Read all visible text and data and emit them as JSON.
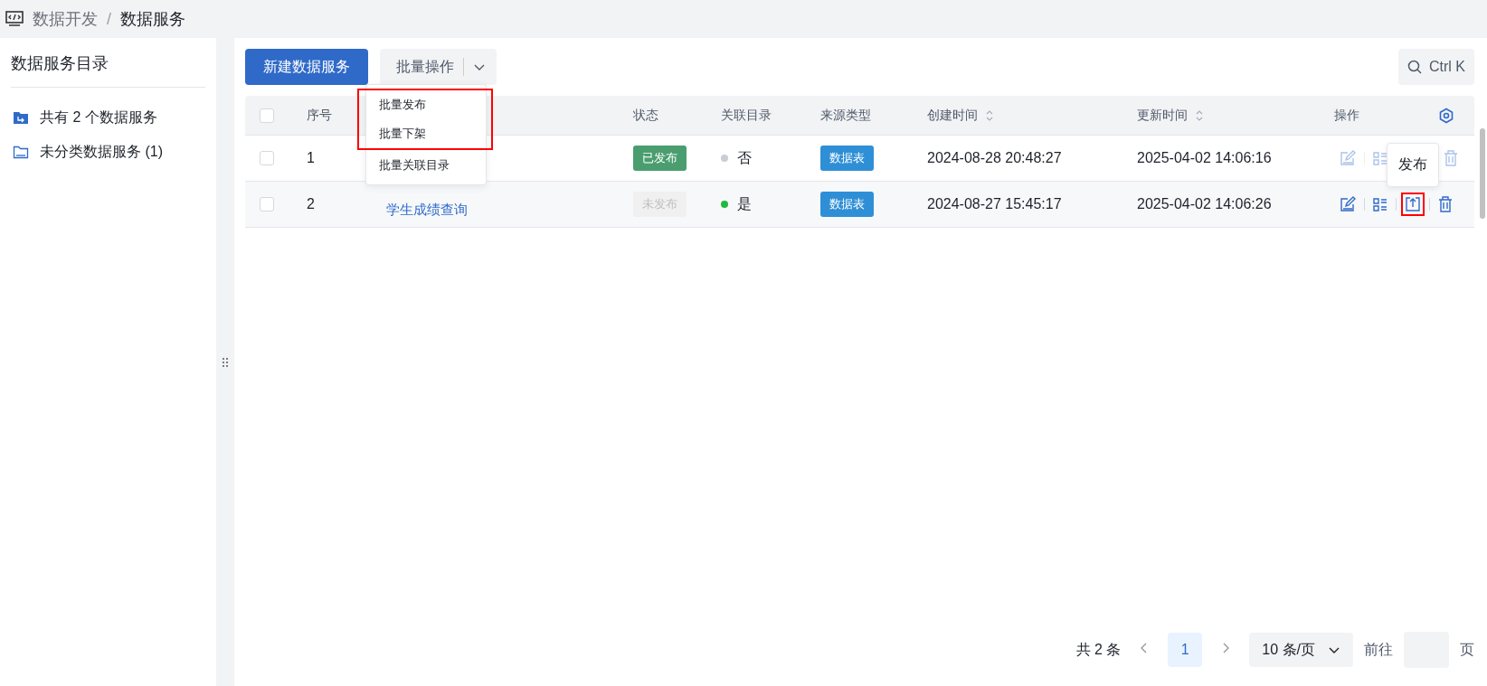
{
  "breadcrumb": [
    "数据开发",
    "数据服务"
  ],
  "breadcrumb_separator": "/",
  "sidebar": {
    "title": "数据服务目录",
    "items": [
      {
        "label": "共有 2 个数据服务",
        "kind": "root"
      },
      {
        "label": "未分类数据服务 (1)",
        "kind": "folder"
      }
    ]
  },
  "toolbar": {
    "create_button": "新建数据服务",
    "batch_button": "批量操作",
    "search_hint": "Ctrl K"
  },
  "batch_menu": [
    {
      "label": "批量发布",
      "highlighted": true
    },
    {
      "label": "批量下架",
      "highlighted": true
    },
    {
      "label": "批量关联目录",
      "highlighted": false
    }
  ],
  "table": {
    "all_checked": false,
    "columns": [
      "序号",
      "状态",
      "关联目录",
      "来源类型",
      "创建时间",
      "更新时间",
      "操作"
    ],
    "rows": [
      {
        "checked": false,
        "index": "1",
        "status": "已发布",
        "published": true,
        "linked": "否",
        "linked_on": false,
        "source": "数据表",
        "created": "2024-08-28 20:48:27",
        "updated": "2025-04-02 14:06:16",
        "actions_enabled": false
      },
      {
        "checked": false,
        "index": "2",
        "name": "学生成绩查询",
        "status": "未发布",
        "published": false,
        "linked": "是",
        "linked_on": true,
        "source": "数据表",
        "created": "2024-08-27 15:45:17",
        "updated": "2025-04-02 14:06:26",
        "actions_enabled": true,
        "publish_highlighted": true,
        "publish_tooltip": "发布"
      }
    ]
  },
  "pagination": {
    "total": "共 2 条",
    "pages": [
      {
        "label": "1",
        "selected": true
      }
    ],
    "page_size": "10 条/页",
    "goto": "前往",
    "page_unit": "页"
  }
}
